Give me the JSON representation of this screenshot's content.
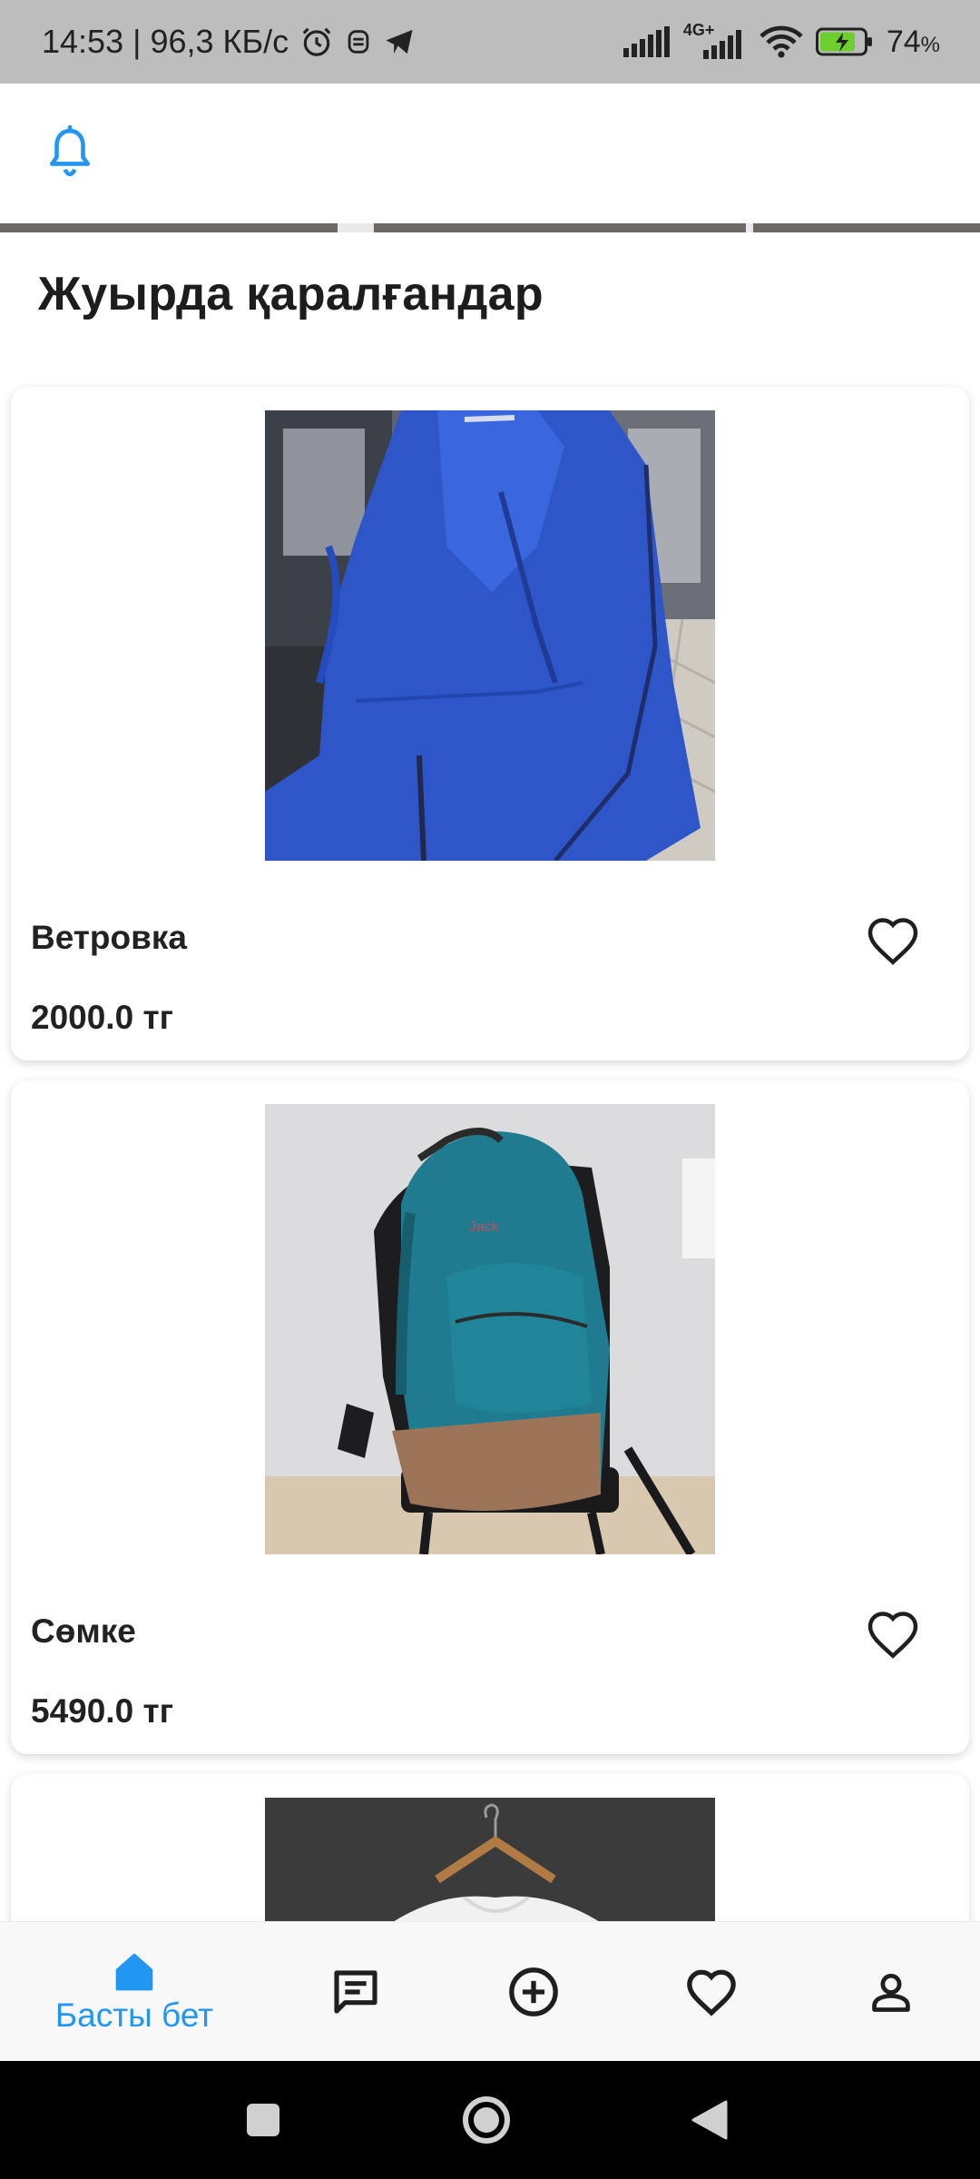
{
  "status_bar": {
    "time_speed": "14:53 | 96,3 КБ/с",
    "network": "4G+",
    "battery": "74",
    "battery_unit": "%"
  },
  "section": {
    "title": "Жуырда қаралғандар"
  },
  "products": [
    {
      "name": "Ветровка",
      "price": "2000.0 тг",
      "image": "blue-jacket-photo",
      "favorited": false
    },
    {
      "name": "Сөмке",
      "price": "5490.0 тг",
      "image": "teal-backpack-photo",
      "favorited": false
    },
    {
      "name": "",
      "price": "",
      "image": "white-tshirt-on-hanger-photo",
      "favorited": false
    }
  ],
  "bottom_nav": {
    "items": [
      {
        "id": "home",
        "label": "Басты бет",
        "icon": "home-icon",
        "active": true
      },
      {
        "id": "messages",
        "label": "",
        "icon": "chat-icon",
        "active": false
      },
      {
        "id": "add",
        "label": "",
        "icon": "add-circle-icon",
        "active": false
      },
      {
        "id": "favorites",
        "label": "",
        "icon": "heart-icon",
        "active": false
      },
      {
        "id": "profile",
        "label": "",
        "icon": "person-icon",
        "active": false
      }
    ]
  },
  "colors": {
    "accent": "#2196f3",
    "status_bar_bg": "#bdbdbd",
    "text": "#1f1f1f",
    "system_nav_bg": "#000000"
  }
}
